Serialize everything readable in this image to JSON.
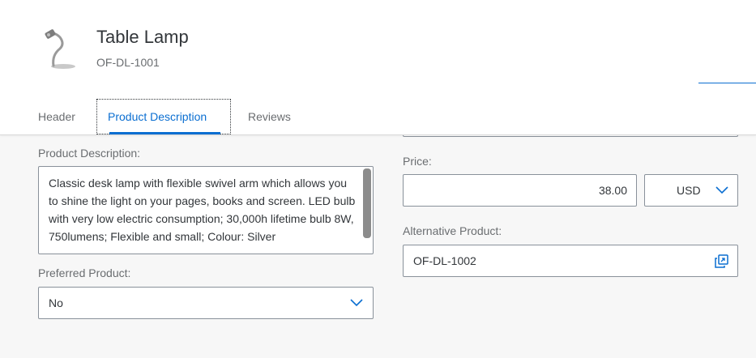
{
  "header": {
    "title": "Table Lamp",
    "subtitle": "OF-DL-1001",
    "thumbnail_icon": "table-lamp-icon"
  },
  "tabs": [
    {
      "label": "Header",
      "selected": false
    },
    {
      "label": "Product Description",
      "selected": true
    },
    {
      "label": "Reviews",
      "selected": false
    }
  ],
  "form": {
    "description_label": "Product Description:",
    "description_value": "Classic desk lamp with flexible swivel arm which allows you to shine the light on your pages, books and screen. LED bulb with very low electric consumption; 30,000h lifetime bulb 8W, 750lumens; Flexible and small; Colour: Silver",
    "preferred_label": "Preferred Product:",
    "preferred_value": "No",
    "price_label": "Price:",
    "price_value": "38.00",
    "currency_value": "USD",
    "alternative_label": "Alternative Product:",
    "alternative_value": "OF-DL-1002"
  },
  "colors": {
    "accent": "#0a6ed1",
    "header_bg": "#ffffff",
    "page_bg": "#f7f7f7",
    "field_border": "#89919a",
    "label_text": "#6a6d70"
  }
}
